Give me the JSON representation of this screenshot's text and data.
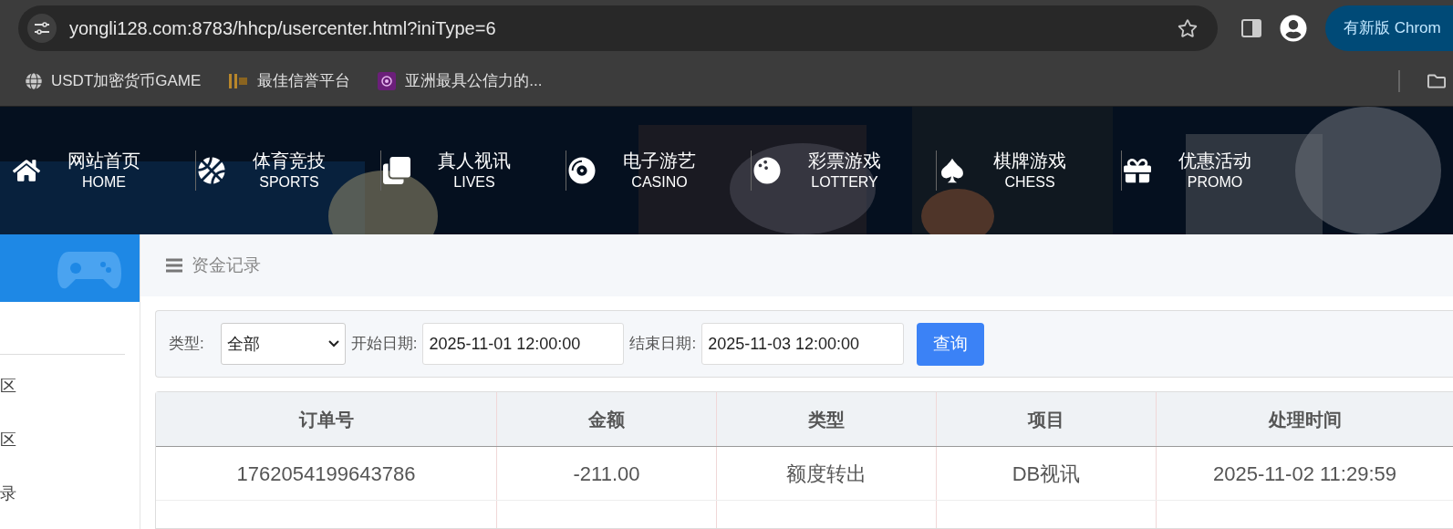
{
  "browser": {
    "url": "yongli128.com:8783/hhcp/usercenter.html?iniType=6",
    "update_button": "有新版 Chrom",
    "bookmarks": [
      {
        "label": "USDT加密货币GAME"
      },
      {
        "label": "最佳信誉平台"
      },
      {
        "label": "亚洲最具公信力的..."
      }
    ]
  },
  "nav": [
    {
      "title": "网站首页",
      "subtitle": "HOME"
    },
    {
      "title": "体育竞技",
      "subtitle": "SPORTS"
    },
    {
      "title": "真人视讯",
      "subtitle": "LIVES"
    },
    {
      "title": "电子游艺",
      "subtitle": "CASINO"
    },
    {
      "title": "彩票游戏",
      "subtitle": "LOTTERY"
    },
    {
      "title": "棋牌游戏",
      "subtitle": "CHESS"
    },
    {
      "title": "优惠活动",
      "subtitle": "PROMO"
    }
  ],
  "sidebar": {
    "items": [
      "区",
      "区",
      "录"
    ]
  },
  "page_title": "资金记录",
  "filter": {
    "type_label": "类型:",
    "type_value": "全部",
    "start_label": "开始日期:",
    "start_value": "2025-11-01 12:00:00",
    "end_label": "结束日期:",
    "end_value": "2025-11-03 12:00:00",
    "button": "查询"
  },
  "table": {
    "columns": [
      "订单号",
      "金额",
      "类型",
      "项目",
      "处理时间"
    ],
    "rows": [
      [
        "1762054199643786",
        "-211.00",
        "额度转出",
        "DB视讯",
        "2025-11-02 11:29:59"
      ]
    ]
  }
}
